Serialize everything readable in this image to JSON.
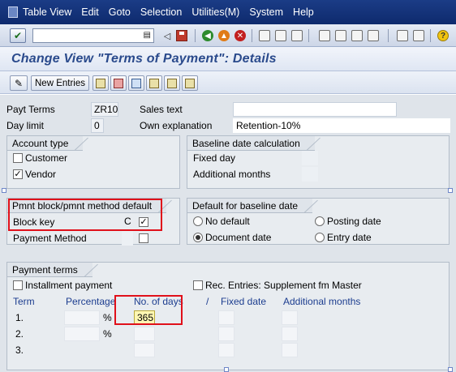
{
  "menu": {
    "items": [
      "Table View",
      "Edit",
      "Goto",
      "Selection",
      "Utilities(M)",
      "System",
      "Help"
    ]
  },
  "title": "Change View \"Terms of Payment\": Details",
  "app_toolbar": {
    "new_entries_label": "New Entries"
  },
  "header_fields": {
    "payt_terms_label": "Payt Terms",
    "payt_terms_value": "ZR10",
    "day_limit_label": "Day limit",
    "day_limit_value": "0",
    "sales_text_label": "Sales text",
    "sales_text_value": "",
    "own_explanation_label": "Own explanation",
    "own_explanation_value": "Retention-10%"
  },
  "account_type": {
    "title": "Account type",
    "customer_label": "Customer",
    "customer_checked": false,
    "vendor_label": "Vendor",
    "vendor_checked": true
  },
  "baseline_calc": {
    "title": "Baseline date calculation",
    "fixed_day_label": "Fixed day",
    "additional_months_label": "Additional months"
  },
  "pmnt_block": {
    "title": "Pmnt block/pmnt method default",
    "block_key_label": "Block key",
    "block_key_value": "C",
    "block_key_checked": true,
    "payment_method_label": "Payment Method",
    "payment_method_checked": false
  },
  "default_baseline": {
    "title": "Default for baseline date",
    "no_default_label": "No default",
    "posting_date_label": "Posting date",
    "document_date_label": "Document date",
    "entry_date_label": "Entry date",
    "selected": "Document date"
  },
  "payment_terms": {
    "title": "Payment terms",
    "installment_label": "Installment payment",
    "installment_checked": false,
    "rec_entries_label": "Rec. Entries: Supplement fm Master",
    "rec_entries_checked": false,
    "col_term": "Term",
    "col_percentage": "Percentage",
    "col_no_of_days": "No. of days",
    "col_slash": "/",
    "col_fixed_date": "Fixed date",
    "col_additional_months": "Additional months",
    "rows": [
      {
        "term": "1.",
        "percent_sign": "%",
        "days": "365"
      },
      {
        "term": "2.",
        "percent_sign": "%",
        "days": ""
      },
      {
        "term": "3.",
        "percent_sign": "",
        "days": ""
      }
    ]
  },
  "colors": {
    "menubar": "#1b3c86",
    "title_text": "#2a4a8c",
    "highlight_red": "#e0101a",
    "panel_bg": "#dfe4ea",
    "selected_input_bg": "#fff7b3"
  }
}
